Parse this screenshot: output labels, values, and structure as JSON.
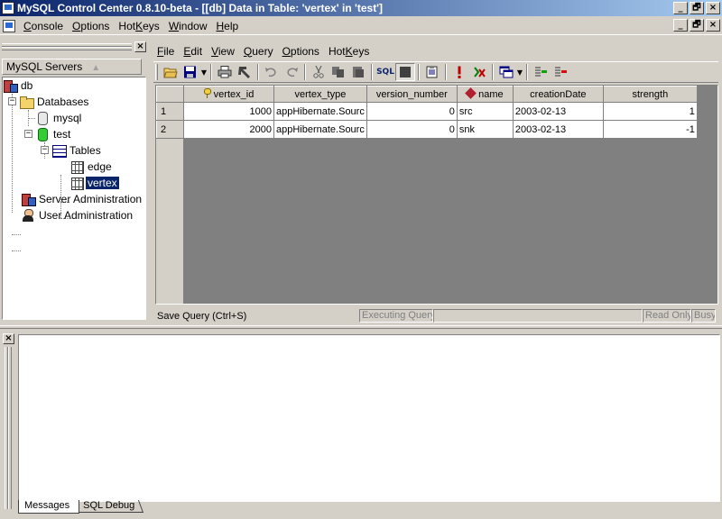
{
  "window": {
    "title": "MySQL Control Center 0.8.10-beta - [[db] Data in Table: 'vertex' in 'test']",
    "buttons": [
      "_",
      "🗗",
      "×"
    ]
  },
  "main_menu": [
    {
      "label": "Console",
      "u": "C",
      "rest": "onsole"
    },
    {
      "label": "Options",
      "u": "O",
      "rest": "ptions"
    },
    {
      "label": "HotKeys",
      "u": "",
      "rest": "Hot",
      "u2": "K",
      "rest2": "eys"
    },
    {
      "label": "Window",
      "u": "W",
      "rest": "indow"
    },
    {
      "label": "Help",
      "u": "H",
      "rest": "elp"
    }
  ],
  "sidebar": {
    "header": "MySQL Servers",
    "header_sort": "▲",
    "close": "×",
    "tree": [
      {
        "label": "db",
        "icon": "server-db-icon"
      },
      {
        "label": "Databases",
        "icon": "folder-icon"
      },
      {
        "label": "mysql",
        "icon": "database-icon"
      },
      {
        "label": "test",
        "icon": "database-green-icon"
      },
      {
        "label": "Tables",
        "icon": "tables-icon"
      },
      {
        "label": "edge",
        "icon": "table-icon"
      },
      {
        "label": "vertex",
        "icon": "table-icon",
        "selected": true
      },
      {
        "label": "Server Administration",
        "icon": "server-admin-icon"
      },
      {
        "label": "User Administration",
        "icon": "user-admin-icon"
      }
    ]
  },
  "data_window": {
    "menu": [
      {
        "label": "File",
        "u": "F",
        "rest": "ile"
      },
      {
        "label": "Edit",
        "u": "E",
        "rest": "dit"
      },
      {
        "label": "View",
        "u": "V",
        "rest": "iew"
      },
      {
        "label": "Query",
        "u": "Q",
        "rest": "uery"
      },
      {
        "label": "Options",
        "u": "O",
        "rest": "ptions"
      },
      {
        "label": "HotKeys",
        "pre": "Hot",
        "u": "K",
        "rest": "eys"
      }
    ],
    "sql_label": "SQL",
    "columns": [
      "vertex_id",
      "vertex_type",
      "version_number",
      "name",
      "creationDate",
      "strength"
    ],
    "rows": [
      {
        "num": "1",
        "cells": [
          "1000",
          "appHibernate.Sourc",
          "0",
          "src",
          "2003-02-13",
          "1"
        ]
      },
      {
        "num": "2",
        "cells": [
          "2000",
          "appHibernate.Sourc",
          "0",
          "snk",
          "2003-02-13",
          "-1"
        ]
      }
    ],
    "status": {
      "save_query": "Save Query (Ctrl+S)",
      "executing": "Executing Query",
      "readonly": "Read Only",
      "busy": "Busy"
    }
  },
  "bottom": {
    "close": "×",
    "tabs": [
      "Messages",
      "SQL Debug"
    ],
    "active_tab": "Messages"
  }
}
